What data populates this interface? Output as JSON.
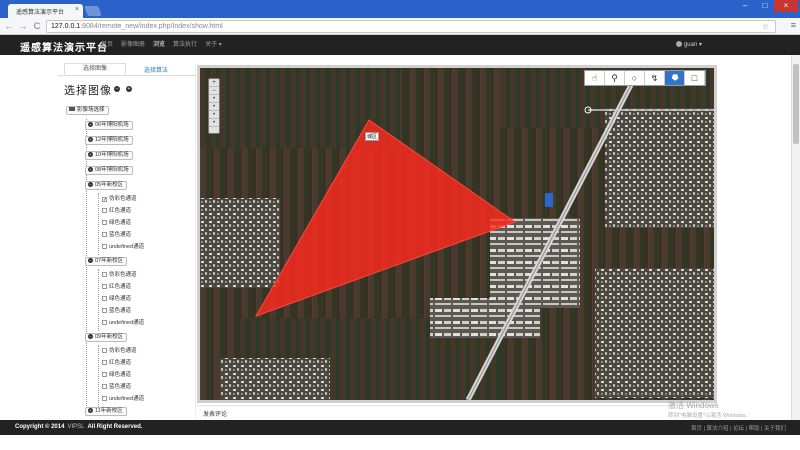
{
  "browser": {
    "tab_title": "遥感算法演示平台",
    "tab_close": "×",
    "url_host": "127.0.0.1",
    "url_rest": ":8084/remote_new/index.php/Index/show.html",
    "back": "←",
    "forward": "→",
    "reload": "C",
    "star": "☆",
    "menu": "≡",
    "win_min": "–",
    "win_max": "□",
    "win_close": "×"
  },
  "navbar": {
    "brand": "遥感算法演示平台",
    "links": [
      "首页",
      "影像图册",
      "浏览",
      "算法执行",
      "关于 ▾"
    ],
    "user": "guan ▾"
  },
  "left_panel": {
    "tabs": [
      "选择图像",
      "选择算法"
    ],
    "title": "选择图像",
    "minus": "−",
    "plus": "+",
    "root": "影像场选择",
    "groups_top": [
      "06年博阳机场",
      "12年博阳机场",
      "10年博阳机场",
      "08年博阳机场"
    ],
    "group_a": "05年新校区",
    "group_b": "07年新校区",
    "group_c": "09年新校区",
    "group_d": "11年新校区",
    "leaves": [
      "伪彩色通道",
      "红色通道",
      "绿色通道",
      "蓝色通道",
      "undefined通道"
    ],
    "checked_mark": "✓"
  },
  "map": {
    "tools": [
      "☝",
      "⚲",
      "○",
      "↯",
      "⯂",
      "□"
    ],
    "zoom": [
      "+",
      "−",
      "•",
      "•",
      "•",
      "•"
    ],
    "polygon_label": "城区",
    "polygon_color": "#ff2a1f"
  },
  "comment_label": "发表评论",
  "watermark": {
    "line1": "激活 Windows",
    "line2": "转到\"电脑设置\"以激活 Windows。"
  },
  "footer": {
    "copyright": "Copyright © 2014",
    "brandmark": "VIPSL",
    "rights": "All Right Reserved.",
    "links": "首页 | 算法介绍 | 论坛 | 帮助 | 关于我们"
  }
}
